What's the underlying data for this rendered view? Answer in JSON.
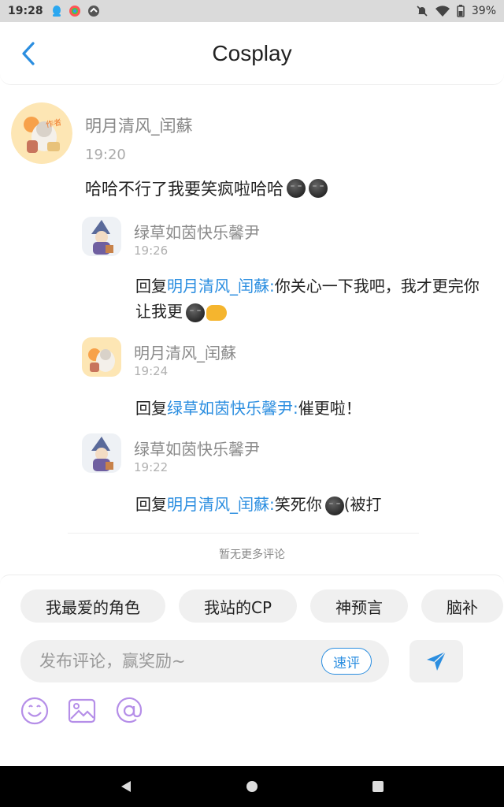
{
  "status_bar": {
    "time": "19:28",
    "battery": "39%"
  },
  "header": {
    "title": "Cosplay"
  },
  "main_comment": {
    "author": "明月清风_闰蘇",
    "time": "19:20",
    "text": "哈哈不行了我要笑疯啦哈哈",
    "avatar_badge": "作者"
  },
  "replies": [
    {
      "author": "绿草如茵快乐馨尹",
      "time": "19:26",
      "prefix": "回复",
      "mention": "明月清风_闰蘇:",
      "text": "你关心一下我吧，我才更完你让我更"
    },
    {
      "author": "明月清风_闰蘇",
      "time": "19:24",
      "prefix": "回复",
      "mention": "绿草如茵快乐馨尹:",
      "text": "催更啦！"
    },
    {
      "author": "绿草如茵快乐馨尹",
      "time": "19:22",
      "prefix": "回复",
      "mention": "明月清风_闰蘇:",
      "text": "笑死你",
      "suffix": "(被打"
    }
  ],
  "no_more_text": "暂无更多评论",
  "quick_tags": [
    "我最爱的角色",
    "我站的CP",
    "神预言",
    "脑补"
  ],
  "comment_input": {
    "placeholder": "发布评论，赢奖励~",
    "quick_rate_label": "速评"
  },
  "colors": {
    "accent": "#2b8ee0",
    "tool_icon": "#b58ee8"
  }
}
